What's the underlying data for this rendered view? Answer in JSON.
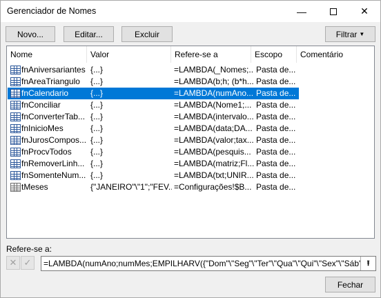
{
  "window": {
    "title": "Gerenciador de Nomes",
    "minimize_icon": "minimize-icon",
    "maximize_icon": "maximize-icon",
    "close_icon": "close-icon"
  },
  "toolbar": {
    "new_label": "Novo...",
    "edit_label": "Editar...",
    "delete_label": "Excluir",
    "filter_label": "Filtrar",
    "filter_icon": "dropdown-arrow-icon"
  },
  "list": {
    "columns": [
      "Nome",
      "Valor",
      "Refere-se a",
      "Escopo",
      "Comentário"
    ],
    "rows": [
      {
        "name": "fnAniversariantes",
        "value": "{...}",
        "refers": "=LAMBDA(_Nomes;...",
        "scope": "Pasta de...",
        "comment": "",
        "icon": "table-name-icon"
      },
      {
        "name": "fnAreaTriangulo",
        "value": "{...}",
        "refers": "=LAMBDA(b;h; (b*h...",
        "scope": "Pasta de...",
        "comment": "",
        "icon": "table-name-icon"
      },
      {
        "name": "fnCalendario",
        "value": "{...}",
        "refers": "=LAMBDA(numAno...",
        "scope": "Pasta de...",
        "comment": "",
        "icon": "table-name-icon",
        "selected": true
      },
      {
        "name": "fnConciliar",
        "value": "{...}",
        "refers": "=LAMBDA(Nome1;...",
        "scope": "Pasta de...",
        "comment": "",
        "icon": "table-name-icon"
      },
      {
        "name": "fnConverterTab...",
        "value": "{...}",
        "refers": "=LAMBDA(intervalo...",
        "scope": "Pasta de...",
        "comment": "",
        "icon": "table-name-icon"
      },
      {
        "name": "fnInicioMes",
        "value": "{...}",
        "refers": "=LAMBDA(data;DA...",
        "scope": "Pasta de...",
        "comment": "",
        "icon": "table-name-icon"
      },
      {
        "name": "fnJurosCompos...",
        "value": "{...}",
        "refers": "=LAMBDA(valor;tax...",
        "scope": "Pasta de...",
        "comment": "",
        "icon": "table-name-icon"
      },
      {
        "name": "fnProcvTodos",
        "value": "{...}",
        "refers": "=LAMBDA(pesquis...",
        "scope": "Pasta de...",
        "comment": "",
        "icon": "table-name-icon"
      },
      {
        "name": "fnRemoverLinh...",
        "value": "{...}",
        "refers": "=LAMBDA(matriz;Fl...",
        "scope": "Pasta de...",
        "comment": "",
        "icon": "table-name-icon"
      },
      {
        "name": "fnSomenteNum...",
        "value": "{...}",
        "refers": "=LAMBDA(txt;UNIR...",
        "scope": "Pasta de...",
        "comment": "",
        "icon": "table-name-icon"
      },
      {
        "name": "tMeses",
        "value": "{\"JANEIRO\"\\\"1\";\"FEV...",
        "refers": "=Configurações!$B...",
        "scope": "Pasta de...",
        "comment": "",
        "icon": "table-icon"
      }
    ]
  },
  "refers_to": {
    "label": "Refere-se a:",
    "formula": "=LAMBDA(numAno;numMes;EMPILHARV({\"Dom\"\\\"Seg\"\\\"Ter\"\\\"Qua\"\\\"Qui\"\\\"Sex\"\\\"Sáb\"};SEQU",
    "cancel_icon": "cancel-x-icon",
    "confirm_icon": "confirm-check-icon",
    "collapse_icon": "collapse-dialog-icon"
  },
  "footer": {
    "close_label": "Fechar"
  }
}
